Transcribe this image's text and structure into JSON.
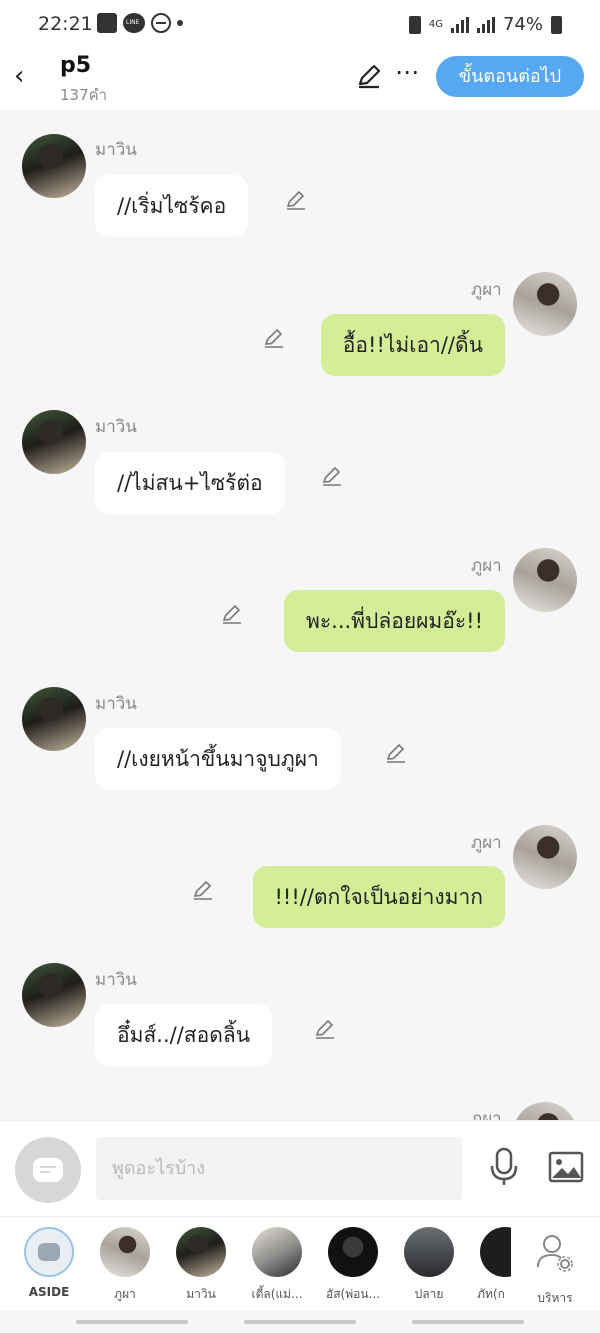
{
  "status": {
    "time": "22:21",
    "network": "4G",
    "battery": "74%"
  },
  "header": {
    "title": "p5",
    "count": "137คำ",
    "next_label": "ขั้นตอนต่อไป"
  },
  "messages": [
    {
      "side": "left",
      "sender": "มาวิน",
      "text": "//เริ่มไซร้คอ"
    },
    {
      "side": "right",
      "sender": "ภูผา",
      "text": "อื้อ!!ไม่เอา//ดิ้น"
    },
    {
      "side": "left",
      "sender": "มาวิน",
      "text": "//ไม่สน+ไซร้ต่อ"
    },
    {
      "side": "right",
      "sender": "ภูผา",
      "text": "พะ...พี่ปล่อยผมอ๊ะ!!"
    },
    {
      "side": "left",
      "sender": "มาวิน",
      "text": "//เงยหน้าขึ้นมาจูบภูผา"
    },
    {
      "side": "right",
      "sender": "ภูผา",
      "text": "!!!//ตกใจเป็นอย่างมาก"
    },
    {
      "side": "left",
      "sender": "มาวิน",
      "text": "อึ๋มส์..//สอดลิ้น"
    },
    {
      "side": "right",
      "sender": "ภูผา",
      "text": ""
    }
  ],
  "input": {
    "placeholder": "พูดอะไรบ้าง"
  },
  "characters": [
    {
      "name": "ASIDE"
    },
    {
      "name": "ภูผา"
    },
    {
      "name": "มาวิน"
    },
    {
      "name": "เตี้ล(แม่..."
    },
    {
      "name": "อัส(พ่อน..."
    },
    {
      "name": "ปลาย"
    },
    {
      "name": "ภัท(ก"
    },
    {
      "name": "บริหาร"
    }
  ],
  "colors": {
    "accent": "#55a8f1",
    "bubble_right": "#d4ee98",
    "bubble_left": "#ffffff",
    "background": "#f6f6f6"
  }
}
